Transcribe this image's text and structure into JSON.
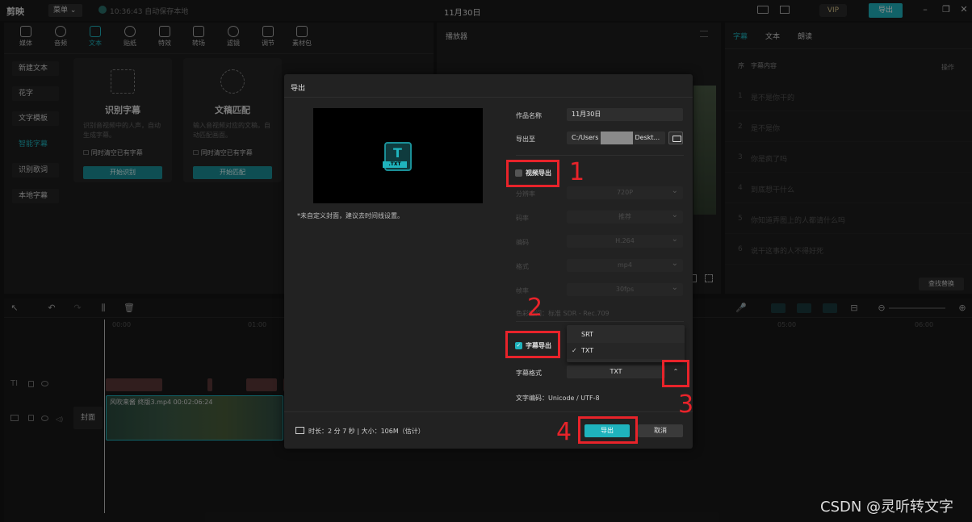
{
  "topbar": {
    "logo": "剪映",
    "menu": "菜单 ⌄",
    "autosave": "10:36:43 自动保存本地",
    "title": "11月30日",
    "vip": "VIP",
    "export": "导出"
  },
  "toolbar_tabs": [
    "媒体",
    "音频",
    "文本",
    "贴纸",
    "特效",
    "转场",
    "滤镜",
    "调节",
    "素材包"
  ],
  "text_sidebar": [
    "新建文本",
    "花字",
    "文字模板",
    "智能字幕",
    "识别歌词",
    "本地字幕"
  ],
  "cards": [
    {
      "title": "识别字幕",
      "desc": "识别音视频中的人声，自动生成字幕。",
      "check": "同时清空已有字幕",
      "button": "开始识别"
    },
    {
      "title": "文稿匹配",
      "desc": "输入音视频对应的文稿，自动匹配画面。",
      "check": "同时清空已有字幕",
      "button": "开始匹配"
    }
  ],
  "player": {
    "title": "播放器"
  },
  "right_panel": {
    "tabs": [
      "字幕",
      "文本",
      "朗读"
    ],
    "header_num": "序",
    "header_content": "字幕内容",
    "header_action": "操作",
    "rows": [
      {
        "num": "1",
        "text": "是不是你干的"
      },
      {
        "num": "2",
        "text": "是不是你"
      },
      {
        "num": "3",
        "text": "你是疯了吗"
      },
      {
        "num": "4",
        "text": "到底想干什么"
      },
      {
        "num": "5",
        "text": "你知道弄图上的人都请什么吗"
      },
      {
        "num": "6",
        "text": "说干这事的人不得好死"
      }
    ],
    "find_replace": "查找替换"
  },
  "timeline": {
    "ruler": [
      "00:00",
      "01:00",
      "05:00",
      "06:00"
    ],
    "clip_label": "风吹来酱 终版3.mp4  00:02:06:24",
    "cover": "封面"
  },
  "modal": {
    "title": "导出",
    "cover_note": "*未自定义封面，建议去时间线设置。",
    "name_label": "作品名称",
    "name_value": "11月30日",
    "path_label": "导出至",
    "path_prefix": "C:/Users",
    "path_suffix": "Deskt...",
    "video_export": "视频导出",
    "video_fields": [
      {
        "label": "分辨率",
        "value": "720P"
      },
      {
        "label": "码率",
        "value": "推荐"
      },
      {
        "label": "编码",
        "value": "H.264"
      },
      {
        "label": "格式",
        "value": "mp4"
      },
      {
        "label": "帧率",
        "value": "30fps"
      }
    ],
    "color_space": "色彩空间：标准 SDR - Rec.709",
    "subtitle_export": "字幕导出",
    "subtitle_format_label": "字幕格式",
    "subtitle_format_value": "TXT",
    "format_options": [
      "SRT",
      "TXT"
    ],
    "selected_format": "TXT",
    "encoding": "文字编码：Unicode / UTF-8",
    "footer_info": "时长：2 分 7 秒 | 大小：106M（估计）",
    "export_button": "导出",
    "cancel_button": "取消",
    "video_export_checked": false,
    "subtitle_export_checked": true
  },
  "annotations": [
    "1",
    "2",
    "3",
    "4"
  ],
  "watermark": "CSDN @灵听转文字",
  "colors": {
    "accent": "#1fb3bd",
    "annotation": "#e8232a"
  }
}
